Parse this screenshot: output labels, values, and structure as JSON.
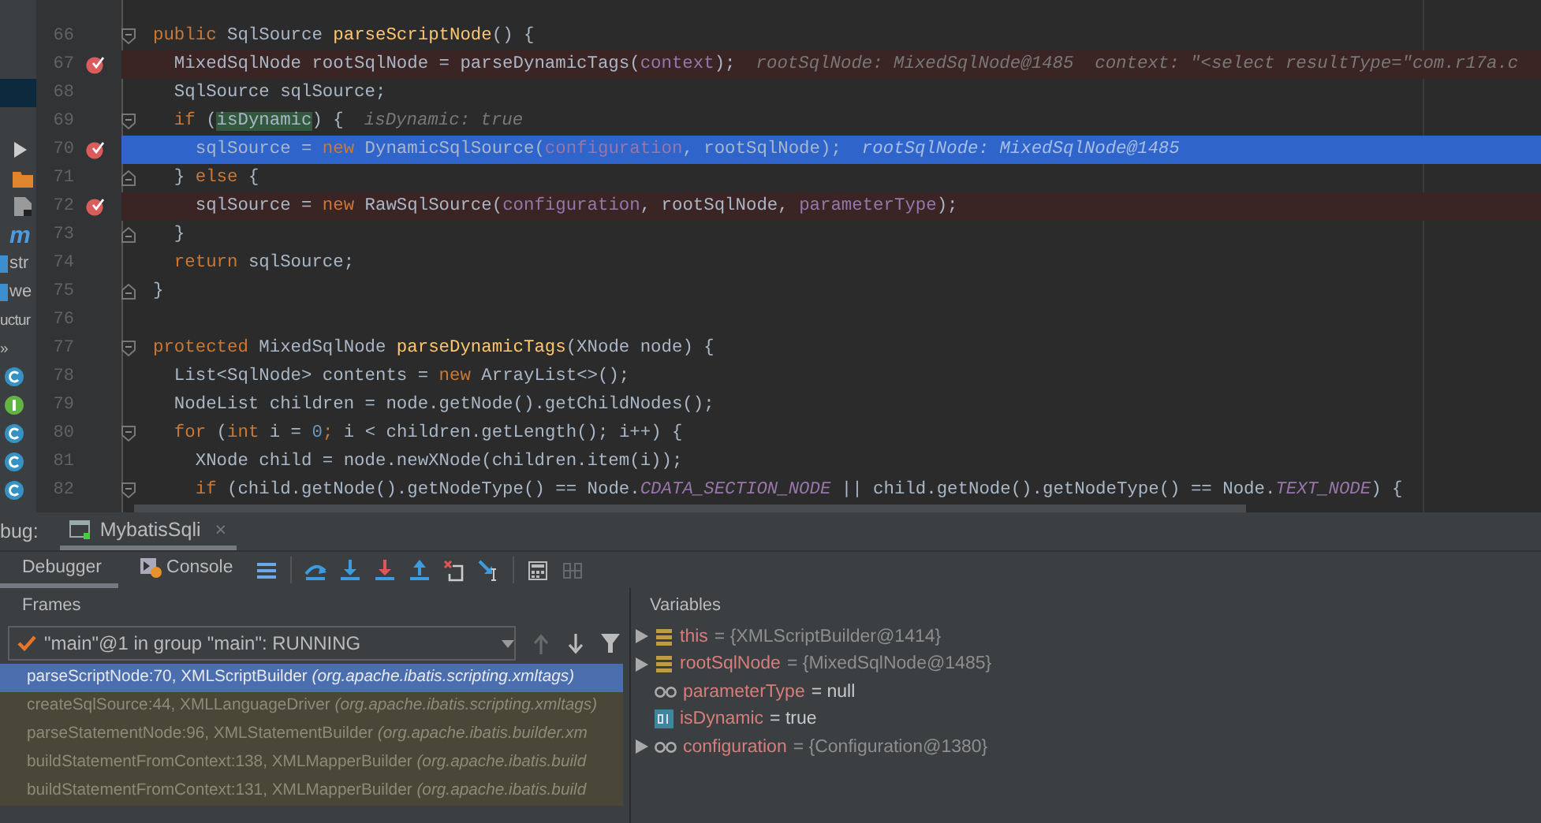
{
  "left_panel": {
    "items": [
      {
        "kind": "row",
        "selected": true
      },
      {
        "kind": "run",
        "selected": false
      },
      {
        "kind": "folder",
        "selected": false
      },
      {
        "kind": "file",
        "selected": false
      },
      {
        "kind": "module",
        "text": "m",
        "selected": false
      },
      {
        "kind": "file",
        "text": "str",
        "selected": false
      },
      {
        "kind": "file",
        "text": "we",
        "selected": false
      },
      {
        "kind": "label",
        "text": "uctur",
        "selected": false
      },
      {
        "kind": "label",
        "text": "»",
        "selected": false
      },
      {
        "kind": "class",
        "selected": false
      },
      {
        "kind": "interface",
        "selected": false
      },
      {
        "kind": "class",
        "selected": false
      },
      {
        "kind": "class",
        "selected": false
      },
      {
        "kind": "class",
        "selected": false
      }
    ]
  },
  "editor": {
    "lines": [
      {
        "number": "66",
        "kind": "fold-start",
        "breakpoint": false,
        "current": false,
        "tokens": [
          {
            "kind": "kw",
            "text": "public "
          },
          {
            "kind": "plain",
            "text": "SqlSource "
          },
          {
            "kind": "fn",
            "text": "parseScriptNode"
          },
          {
            "kind": "plain",
            "text": "() {"
          }
        ]
      },
      {
        "number": "67",
        "kind": "plain",
        "breakpoint": true,
        "current": false,
        "tokens": [
          {
            "kind": "plain",
            "text": "  MixedSqlNode rootSqlNode = parseDynamicTags("
          },
          {
            "kind": "field",
            "text": "context"
          },
          {
            "kind": "plain",
            "text": ");"
          }
        ],
        "hint": "rootSqlNode: MixedSqlNode@1485  context: \"<select resultType=\"com.r17a.c"
      },
      {
        "number": "68",
        "kind": "plain",
        "breakpoint": false,
        "current": false,
        "tokens": [
          {
            "kind": "plain",
            "text": "  SqlSource sqlSource;"
          }
        ]
      },
      {
        "number": "69",
        "kind": "fold-start",
        "breakpoint": false,
        "current": false,
        "tokens": [
          {
            "kind": "kw",
            "text": "  if "
          },
          {
            "kind": "plain",
            "text": "("
          },
          {
            "kind": "match",
            "text": "isDynamic"
          },
          {
            "kind": "plain",
            "text": ") {"
          }
        ],
        "hint": "isDynamic: true"
      },
      {
        "number": "70",
        "kind": "plain",
        "breakpoint": true,
        "current": true,
        "tokens": [
          {
            "kind": "plain",
            "text": "    sqlSource = "
          },
          {
            "kind": "kw",
            "text": "new "
          },
          {
            "kind": "plain",
            "text": "DynamicSqlSource("
          },
          {
            "kind": "field",
            "text": "configuration"
          },
          {
            "kind": "plain",
            "text": ", rootSqlNode);"
          }
        ],
        "hint": "rootSqlNode: MixedSqlNode@1485"
      },
      {
        "number": "71",
        "kind": "fold-end",
        "breakpoint": false,
        "current": false,
        "tokens": [
          {
            "kind": "plain",
            "text": "  } "
          },
          {
            "kind": "kw",
            "text": "else "
          },
          {
            "kind": "plain",
            "text": "{"
          }
        ]
      },
      {
        "number": "72",
        "kind": "plain",
        "breakpoint": true,
        "current": false,
        "tokens": [
          {
            "kind": "plain",
            "text": "    sqlSource = "
          },
          {
            "kind": "kw",
            "text": "new "
          },
          {
            "kind": "plain",
            "text": "RawSqlSource("
          },
          {
            "kind": "field",
            "text": "configuration"
          },
          {
            "kind": "plain",
            "text": ", rootSqlNode, "
          },
          {
            "kind": "field",
            "text": "parameterType"
          },
          {
            "kind": "plain",
            "text": ");"
          }
        ]
      },
      {
        "number": "73",
        "kind": "fold-end",
        "breakpoint": false,
        "current": false,
        "tokens": [
          {
            "kind": "plain",
            "text": "  }"
          }
        ]
      },
      {
        "number": "74",
        "kind": "plain",
        "breakpoint": false,
        "current": false,
        "tokens": [
          {
            "kind": "kw",
            "text": "  return "
          },
          {
            "kind": "plain",
            "text": "sqlSource;"
          }
        ]
      },
      {
        "number": "75",
        "kind": "fold-end",
        "breakpoint": false,
        "current": false,
        "tokens": [
          {
            "kind": "plain",
            "text": "}"
          }
        ]
      },
      {
        "number": "76",
        "kind": "plain",
        "breakpoint": false,
        "current": false
      },
      {
        "number": "77",
        "kind": "fold-start",
        "breakpoint": false,
        "current": false,
        "tokens": [
          {
            "kind": "kw",
            "text": "protected "
          },
          {
            "kind": "plain",
            "text": "MixedSqlNode "
          },
          {
            "kind": "fn",
            "text": "parseDynamicTags"
          },
          {
            "kind": "plain",
            "text": "(XNode node) {"
          }
        ]
      },
      {
        "number": "78",
        "kind": "plain",
        "breakpoint": false,
        "current": false,
        "tokens": [
          {
            "kind": "plain",
            "text": "  List<SqlNode> contents = "
          },
          {
            "kind": "kw",
            "text": "new "
          },
          {
            "kind": "plain",
            "text": "ArrayList<>();"
          }
        ]
      },
      {
        "number": "79",
        "kind": "plain",
        "breakpoint": false,
        "current": false,
        "tokens": [
          {
            "kind": "plain",
            "text": "  NodeList children = node.getNode().getChildNodes();"
          }
        ]
      },
      {
        "number": "80",
        "kind": "fold-start",
        "breakpoint": false,
        "current": false,
        "tokens": [
          {
            "kind": "kw",
            "text": "  for "
          },
          {
            "kind": "plain",
            "text": "("
          },
          {
            "kind": "kw",
            "text": "int "
          },
          {
            "kind": "plain",
            "text": "i = "
          },
          {
            "kind": "num",
            "text": "0"
          },
          {
            "kind": "kw",
            "text": "; "
          },
          {
            "kind": "plain",
            "text": "i < children.getLength(); i++) {"
          }
        ]
      },
      {
        "number": "81",
        "kind": "plain",
        "breakpoint": false,
        "current": false,
        "tokens": [
          {
            "kind": "plain",
            "text": "    XNode child = node.newXNode(children.item(i));"
          }
        ]
      },
      {
        "number": "82",
        "kind": "fold-start",
        "breakpoint": false,
        "current": false,
        "tokens": [
          {
            "kind": "kw",
            "text": "    if "
          },
          {
            "kind": "plain",
            "text": "(child.getNode().getNodeType() == Node."
          },
          {
            "kind": "const",
            "text": "CDATA_SECTION_NODE"
          },
          {
            "kind": "plain",
            "text": " || child.getNode().getNodeType() == Node."
          },
          {
            "kind": "const",
            "text": "TEXT_NODE"
          },
          {
            "kind": "plain",
            "text": ") {"
          }
        ]
      }
    ]
  },
  "debug": {
    "label": "bug:",
    "tabs": [
      {
        "label": "MybatisSqli",
        "close": "×",
        "selected": true
      }
    ],
    "subtabs": [
      {
        "label": "Debugger",
        "kind": "plain",
        "selected": true
      },
      {
        "label": "Console",
        "kind": "console",
        "selected": false
      }
    ],
    "toolbar": [
      {
        "kind": "layout",
        "disabled": false
      },
      {
        "kind": "divider"
      },
      {
        "kind": "step-over",
        "disabled": false
      },
      {
        "kind": "step-into",
        "disabled": false
      },
      {
        "kind": "force-step-into",
        "disabled": false
      },
      {
        "kind": "step-out",
        "disabled": false
      },
      {
        "kind": "drop-frame",
        "disabled": false
      },
      {
        "kind": "run-to-cursor",
        "disabled": false
      },
      {
        "kind": "divider"
      },
      {
        "kind": "evaluate",
        "disabled": false
      },
      {
        "kind": "trace",
        "disabled": true
      }
    ],
    "frames": {
      "title": "Frames",
      "thread": "\"main\"@1 in group \"main\": RUNNING",
      "nav": [
        {
          "kind": "up",
          "disabled": true
        },
        {
          "kind": "down",
          "disabled": false
        },
        {
          "kind": "filter",
          "disabled": false
        }
      ],
      "items": [
        {
          "text": "parseScriptNode:70, XMLScriptBuilder *(org.apache.ibatis.scripting.xmltags)*",
          "selected": true
        },
        {
          "text": "createSqlSource:44, XMLLanguageDriver *(org.apache.ibatis.scripting.xmltags)*",
          "selected": false
        },
        {
          "text": "parseStatementNode:96, XMLStatementBuilder *(org.apache.ibatis.builder.xm*",
          "selected": false
        },
        {
          "text": "buildStatementFromContext:138, XMLMapperBuilder *(org.apache.ibatis.build*",
          "selected": false
        },
        {
          "text": "buildStatementFromContext:131, XMLMapperBuilder *(org.apache.ibatis.build*",
          "selected": false
        }
      ]
    },
    "variables": {
      "title": "Variables",
      "items": [
        {
          "name": "this",
          "value": "= {XMLScriptBuilder@1414}",
          "kind": "object",
          "expandable": true
        },
        {
          "name": "rootSqlNode",
          "value": "= {MixedSqlNode@1485}",
          "kind": "object",
          "expandable": true
        },
        {
          "name": "parameterType",
          "value": "= null",
          "kind": "field",
          "expandable": false
        },
        {
          "name": "isDynamic",
          "value": "= true",
          "kind": "primitive",
          "expandable": false
        },
        {
          "name": "configuration",
          "value": "= {Configuration@1380}",
          "kind": "field",
          "expandable": true
        }
      ]
    }
  }
}
